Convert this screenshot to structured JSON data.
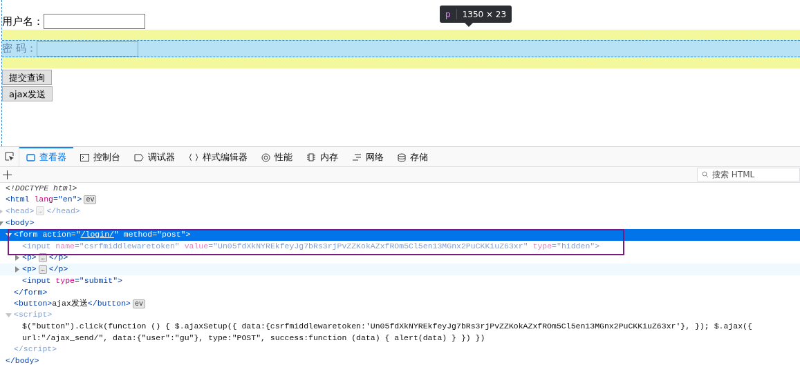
{
  "page": {
    "username_label": "用户名：",
    "password_label": "密 码：",
    "buttons": [
      "提交查询",
      "ajax发送"
    ],
    "tooltip": {
      "tag": "p",
      "size": "1350 × 23"
    }
  },
  "devtools": {
    "tabs": [
      {
        "label": "查看器",
        "selected": true
      },
      {
        "label": "控制台",
        "selected": false
      },
      {
        "label": "调试器",
        "selected": false
      },
      {
        "label": "样式编辑器",
        "selected": false
      },
      {
        "label": "性能",
        "selected": false
      },
      {
        "label": "内存",
        "selected": false
      },
      {
        "label": "网络",
        "selected": false
      },
      {
        "label": "存储",
        "selected": false
      }
    ],
    "search": {
      "placeholder": "搜索 HTML"
    },
    "tree": [
      {
        "parts": [
          {
            "kind": "doctype",
            "text": "<!DOCTYPE html>"
          }
        ],
        "selected": false,
        "hovered": false,
        "dimmed": false
      },
      {
        "parts": [
          {
            "kind": "tag",
            "text": "<html"
          },
          {
            "kind": "attr",
            "text": " lang"
          },
          {
            "kind": "tag",
            "text": "=\"en\">"
          },
          {
            "kind": "badge",
            "text": "ev"
          }
        ],
        "selected": false,
        "hovered": false,
        "dimmed": false
      },
      {
        "expanded": false,
        "parts": [
          {
            "kind": "tag",
            "text": "<head>"
          },
          {
            "kind": "badge",
            "text": "…"
          },
          {
            "kind": "tag",
            "text": "</head>"
          }
        ],
        "selected": false,
        "hovered": false,
        "dimmed": true
      },
      {
        "expanded": true,
        "parts": [
          {
            "kind": "tag",
            "text": "<body>"
          }
        ],
        "selected": false,
        "hovered": false,
        "dimmed": false,
        "close": [
          {
            "kind": "tag",
            "text": "</body>"
          }
        ],
        "children": [
          {
            "expanded": true,
            "parts": [
              {
                "kind": "tag",
                "text": "<form"
              },
              {
                "kind": "attr",
                "text": " action"
              },
              {
                "kind": "tag",
                "text": "=\""
              },
              {
                "kind": "link",
                "text": "/login/"
              },
              {
                "kind": "tag",
                "text": "\""
              },
              {
                "kind": "attr",
                "text": " method"
              },
              {
                "kind": "tag",
                "text": "=\"post\">"
              }
            ],
            "selected": true,
            "hovered": false,
            "dimmed": false,
            "close": [
              {
                "kind": "tag",
                "text": "</form>"
              }
            ],
            "children": [
              {
                "parts": [
                  {
                    "kind": "tag",
                    "text": "<input"
                  },
                  {
                    "kind": "attr",
                    "text": " name"
                  },
                  {
                    "kind": "tag",
                    "text": "=\"csrfmiddlewaretoken\""
                  },
                  {
                    "kind": "attr",
                    "text": " value"
                  },
                  {
                    "kind": "tag",
                    "text": "=\"Un05fdXkNYREkfeyJg7bRs3rjPvZZKokAZxfROm5Cl5en13MGnx2PuCKKiuZ63xr\""
                  },
                  {
                    "kind": "attr",
                    "text": " type"
                  },
                  {
                    "kind": "tag",
                    "text": "=\"hidden\">"
                  }
                ],
                "selected": false,
                "hovered": false,
                "dimmed": true
              },
              {
                "expanded": false,
                "parts": [
                  {
                    "kind": "tag",
                    "text": "<p>"
                  },
                  {
                    "kind": "badge",
                    "text": "…"
                  },
                  {
                    "kind": "tag",
                    "text": "</p>"
                  }
                ],
                "selected": false,
                "hovered": false,
                "dimmed": false
              },
              {
                "expanded": false,
                "parts": [
                  {
                    "kind": "tag",
                    "text": "<p>"
                  },
                  {
                    "kind": "badge",
                    "text": "…"
                  },
                  {
                    "kind": "tag",
                    "text": "</p>"
                  }
                ],
                "selected": false,
                "hovered": true,
                "dimmed": false
              },
              {
                "parts": [
                  {
                    "kind": "tag",
                    "text": "<input"
                  },
                  {
                    "kind": "attr",
                    "text": " type"
                  },
                  {
                    "kind": "tag",
                    "text": "=\"submit\">"
                  }
                ],
                "selected": false,
                "hovered": false,
                "dimmed": false
              }
            ]
          },
          {
            "parts": [
              {
                "kind": "tag",
                "text": "<button>"
              },
              {
                "kind": "text",
                "text": "ajax发送"
              },
              {
                "kind": "tag",
                "text": "</button>"
              },
              {
                "kind": "badge",
                "text": "ev"
              }
            ],
            "selected": false,
            "hovered": false,
            "dimmed": false
          },
          {
            "expanded": true,
            "parts": [
              {
                "kind": "tag",
                "text": "<script>"
              }
            ],
            "selected": false,
            "hovered": false,
            "dimmed": true,
            "close": [
              {
                "kind": "tag",
                "text": "</script>"
              }
            ],
            "children": [
              {
                "parts": [
                  {
                    "kind": "text",
                    "text": "$(\"button\").click(function () { $.ajaxSetup({ data:{csrfmiddlewaretoken:'Un05fdXkNYREkfeyJg7bRs3rjPvZZKokAZxfROm5Cl5en13MGnx2PuCKKiuZ63xr'}, }); $.ajax({ url:\"/ajax_send/\", data:{\"user\":\"gu\"}, type:\"POST\", success:function (data) { alert(data) } }) })"
                  }
                ],
                "selected": false,
                "hovered": false,
                "dimmed": false
              }
            ]
          }
        ]
      }
    ]
  }
}
